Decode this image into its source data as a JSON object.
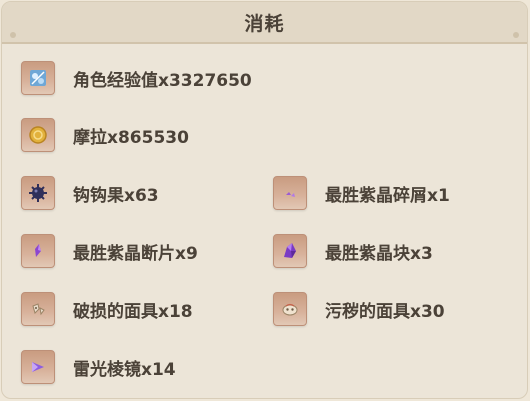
{
  "panel": {
    "title": "消耗"
  },
  "items": [
    {
      "label": "角色经验值x3327650",
      "icon": "character-exp-icon"
    },
    {
      "label": "摩拉x865530",
      "icon": "mora-coin-icon"
    },
    {
      "label": "钩钩果x63",
      "icon": "hook-fruit-icon"
    },
    {
      "label": "最胜紫晶碎屑x1",
      "icon": "amethyst-sliver-icon"
    },
    {
      "label": "最胜紫晶断片x9",
      "icon": "amethyst-fragment-icon"
    },
    {
      "label": "最胜紫晶块x3",
      "icon": "amethyst-chunk-icon"
    },
    {
      "label": "破损的面具x18",
      "icon": "damaged-mask-icon"
    },
    {
      "label": "污秽的面具x30",
      "icon": "stained-mask-icon"
    },
    {
      "label": "雷光棱镜x14",
      "icon": "lightning-prism-icon"
    }
  ]
}
